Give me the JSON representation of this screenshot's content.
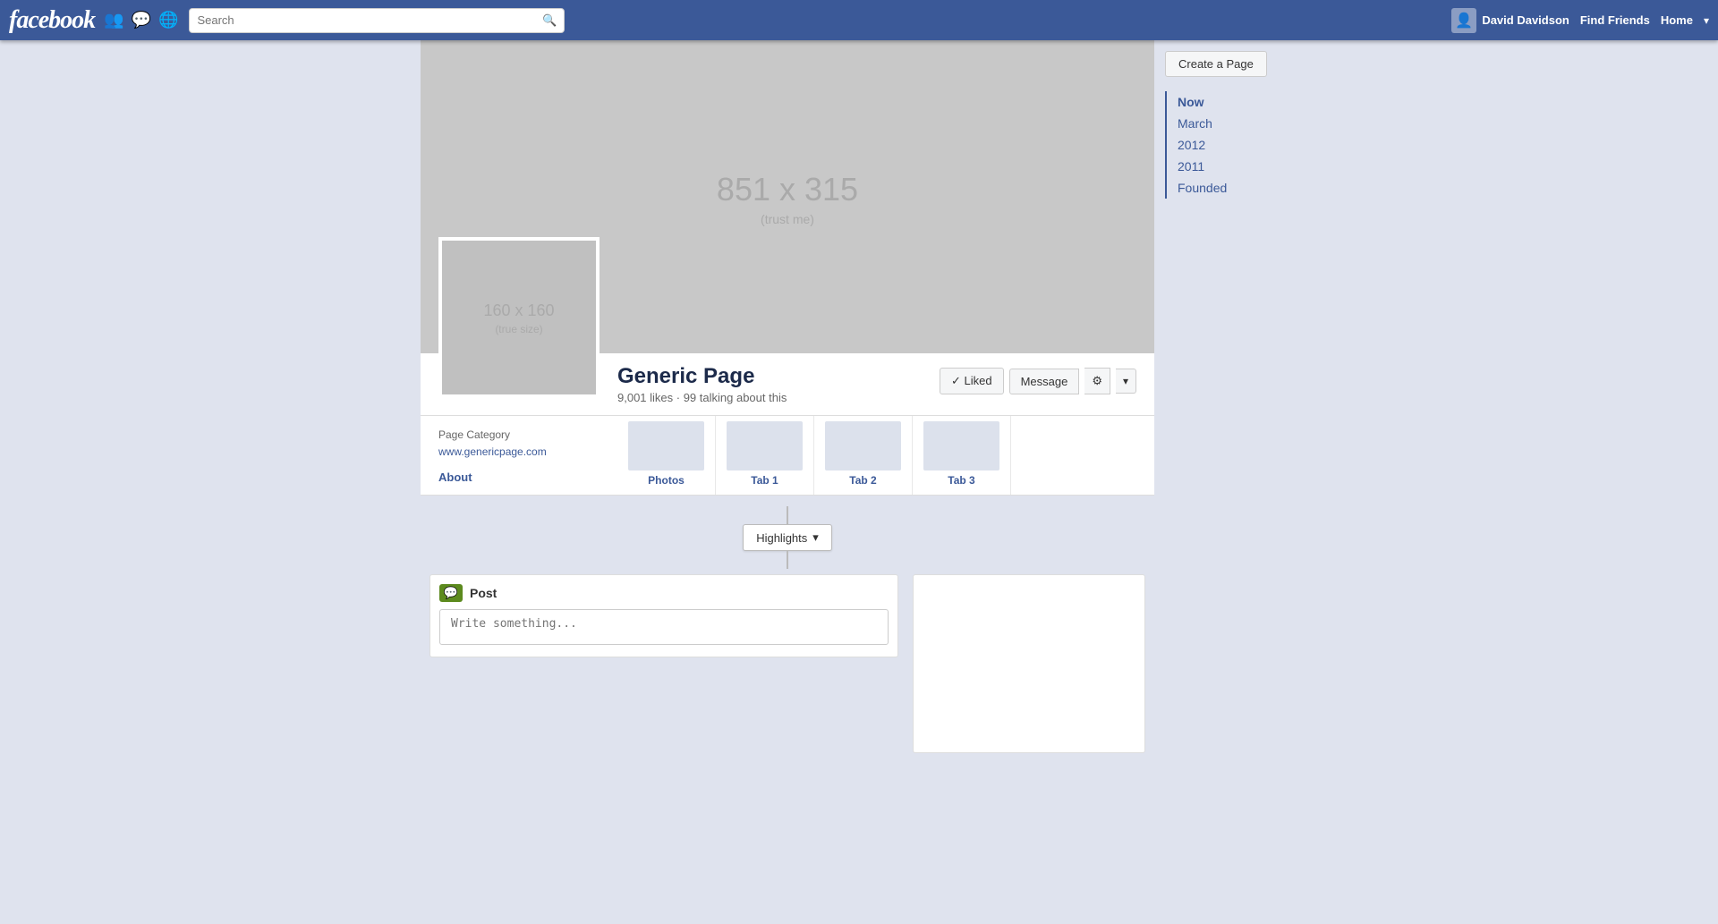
{
  "topnav": {
    "logo": "facebook",
    "search_placeholder": "Search",
    "username": "David Davidson",
    "find_friends": "Find Friends",
    "home": "Home"
  },
  "sidebar": {
    "create_page": "Create a Page",
    "nav_items": [
      {
        "label": "Now",
        "active": true
      },
      {
        "label": "March"
      },
      {
        "label": "2012"
      },
      {
        "label": "2011"
      },
      {
        "label": "Founded"
      }
    ]
  },
  "cover": {
    "dimensions": "851 x 315",
    "sub": "(trust me)"
  },
  "profile_pic": {
    "dimensions": "160 x 160",
    "sub": "(true size)"
  },
  "page": {
    "name": "Generic Page",
    "stats": "9,001 likes · 99 talking about this",
    "liked_label": "✓ Liked",
    "message_label": "Message",
    "settings_icon": "⚙",
    "dropdown_icon": "▾"
  },
  "about_tab": {
    "category": "Page Category",
    "url": "www.genericpage.com",
    "label": "About"
  },
  "tabs": [
    {
      "label": "Photos"
    },
    {
      "label": "Tab 1"
    },
    {
      "label": "Tab 2"
    },
    {
      "label": "Tab 3"
    }
  ],
  "highlights": {
    "label": "Highlights",
    "dropdown": "▾"
  },
  "post_box": {
    "icon": "💬",
    "title": "Post",
    "placeholder": "Write something..."
  }
}
